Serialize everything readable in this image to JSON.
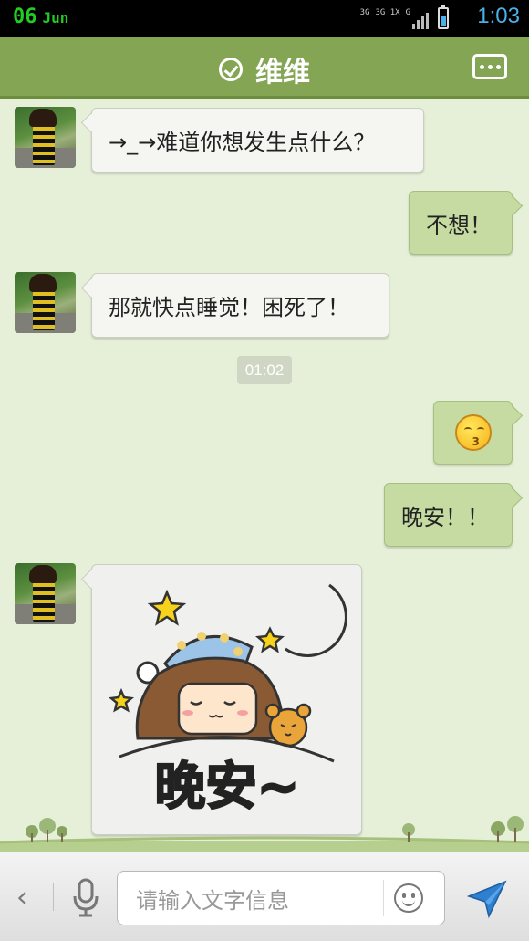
{
  "status_bar": {
    "day": "06",
    "month": "Jun",
    "network1": "3G",
    "network2": "3G 1X",
    "network3": "G",
    "time": "1:03"
  },
  "header": {
    "title": "维维",
    "status_icon": "check-circle-icon",
    "menu_icon": "more-icon"
  },
  "messages": [
    {
      "side": "left",
      "type": "text",
      "text": "→_→难道你想发生点什么？"
    },
    {
      "side": "right",
      "type": "text",
      "text": "不想！"
    },
    {
      "side": "left",
      "type": "text",
      "text": "那就快点睡觉！困死了！"
    },
    {
      "type": "timestamp",
      "text": "01:02"
    },
    {
      "side": "right",
      "type": "emoji",
      "emoji": "kiss-emoji"
    },
    {
      "side": "right",
      "type": "text",
      "text": "晚安！！"
    },
    {
      "side": "left",
      "type": "sticker",
      "caption": "晚安~"
    }
  ],
  "input_bar": {
    "placeholder": "请输入文字信息",
    "back_icon": "chevron-left-icon",
    "voice_icon": "microphone-icon",
    "emoji_icon": "smiley-icon",
    "send_icon": "send-icon"
  },
  "colors": {
    "header_bg": "#84a654",
    "chat_bg": "#e6efd8",
    "right_bubble": "#c5dba1",
    "left_bubble": "#f5f6f2",
    "time_accent": "#4ab0e8"
  }
}
